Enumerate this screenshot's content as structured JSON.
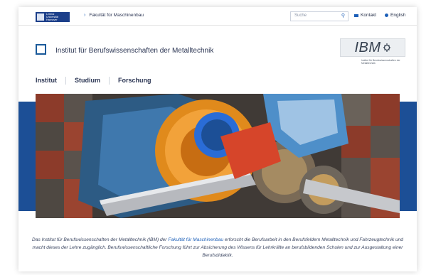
{
  "topbar": {
    "uni_logo_lines": [
      "Leibniz",
      "Universität",
      "Hannover"
    ],
    "breadcrumb": "Fakultät für Maschinenbau",
    "search_placeholder": "Suche",
    "contact_label": "Kontakt",
    "language_label": "English"
  },
  "header": {
    "institute_title": "Institut für Berufswissenschaften der Metalltechnik",
    "ibm_logo_text": "IBM",
    "ibm_logo_subtitle": "Institut für Berufswissenschaften der Metalltechnik"
  },
  "nav": {
    "items": [
      "Institut",
      "Studium",
      "Forschung"
    ]
  },
  "intro": {
    "before_link": "Das Institut für Berufswissenschaften der Metalltechnik (IBM) der ",
    "link": "Fakultät für Maschinenbau",
    "after_link": " erforscht die Berufsarbeit in den Berufsfeldern Metalltechnik und Fahrzeugtechnik und macht dieses der Lehre zugänglich. Berufswissenschaftliche Forschung führt zur Absicherung des Wissens für Lehrkräfte an berufsbildenden Schulen und zur Ausgestaltung einer Berufsdidaktik."
  },
  "colors": {
    "brand_blue": "#1c4f96",
    "link_blue": "#1c5fb8",
    "text": "#2b3553"
  }
}
